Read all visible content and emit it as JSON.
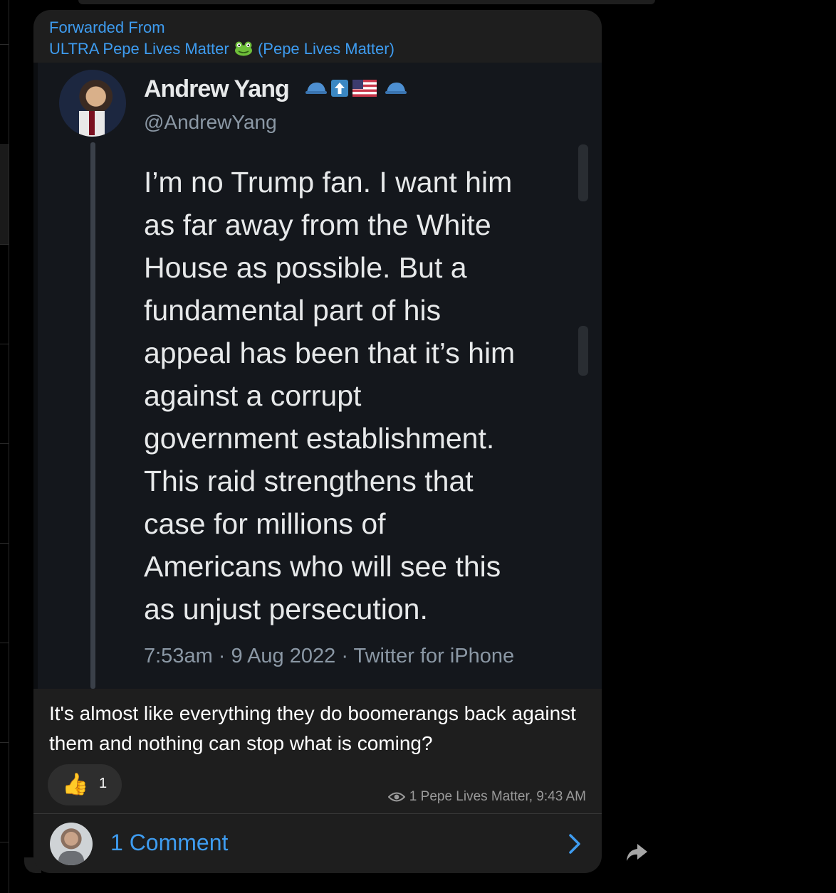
{
  "message": {
    "forwarded_label": "Forwarded From",
    "forwarded_source": "ULTRA Pepe Lives Matter",
    "forwarded_source_emoji": "frog-emoji",
    "forwarded_channel": "(Pepe Lives Matter)",
    "tweet": {
      "name": "Andrew Yang",
      "handle": "@AndrewYang",
      "text": "I’m no Trump fan. I want him\nas far away from the White\nHouse as possible. But a\nfundamental part of his\nappeal has been that it’s him\nagainst a corrupt\ngovernment establishment.\nThis raid strengthens that\ncase for millions of\nAmericans who will see this\nas unjust persecution.",
      "meta": "7:53am · 9 Aug 2022 · Twitter for iPhone"
    },
    "caption": "It's almost like everything they do boomerangs back against them and nothing can stop what is coming?",
    "reaction": {
      "emoji": "👍",
      "count": "1"
    },
    "views_info": "1 Pepe Lives Matter, 9:43 AM",
    "comments_label": "1 Comment"
  },
  "colors": {
    "background": "#000000",
    "bubble": "#1e1e1e",
    "link_blue": "#3e9cf0",
    "tweet_bg": "#14171c"
  }
}
